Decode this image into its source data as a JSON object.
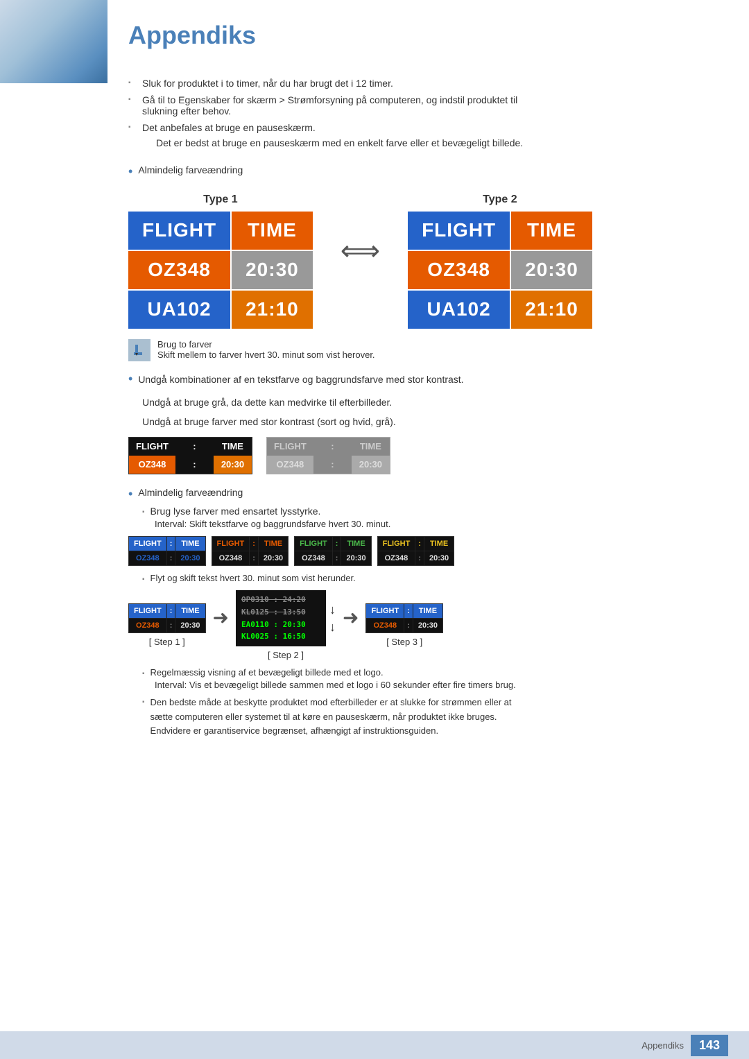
{
  "page": {
    "title": "Appendiks",
    "footer_label": "Appendiks",
    "footer_page": "143"
  },
  "bullets": {
    "b1": "Sluk for produktet i to timer, når du har brugt det i 12 timer.",
    "b2_1": "Gå til to Egenskaber for skærm > Strømforsyning på computeren, og indstil produktet til",
    "b2_2": "slukning efter behov.",
    "b3": "Det anbefales at bruge en pauseskærm.",
    "b3_sub": "Det er bedst at bruge en pauseskærm med en enkelt farve eller et bevægeligt billede.",
    "b_color": "Almindelig farveændring"
  },
  "type_labels": {
    "type1": "Type 1",
    "type2": "Type 2"
  },
  "flight_board_type1": {
    "header_left": "FLIGHT",
    "header_right": "TIME",
    "row1_left": "OZ348",
    "row1_right": "20:30",
    "row2_left": "UA102",
    "row2_right": "21:10"
  },
  "flight_board_type2": {
    "header_left": "FLIGHT",
    "header_right": "TIME",
    "row1_left": "OZ348",
    "row1_right": "20:30",
    "row2_left": "UA102",
    "row2_right": "21:10"
  },
  "note": {
    "label": "Brug to farver",
    "desc": "Skift mellem to farver hvert 30. minut som vist herover."
  },
  "section2": {
    "bullet": "Undgå kombinationer af en tekstfarve og baggrundsfarve med stor kontrast.",
    "line2": "Undgå at bruge grå, da dette kan medvirke til efterbilleder.",
    "line3": "Undgå at bruge farver med stor kontrast (sort og hvid, grå)."
  },
  "contrast_boards": {
    "board1": {
      "header_left": "FLIGHT",
      "header_colon": ":",
      "header_right": "TIME",
      "row_left": "OZ348",
      "row_colon": ":",
      "row_right": "20:30"
    },
    "board2": {
      "header_left": "FLIGHT",
      "header_colon": ":",
      "header_right": "TIME",
      "row_left": "OZ348",
      "row_colon": ":",
      "row_right": "20:30"
    }
  },
  "section3": {
    "bullet": "Almindelig farveændring",
    "sub1": "Brug lyse farver med ensartet lysstyrke.",
    "sub1_note": "Interval: Skift tekstfarve og baggrundsfarve hvert 30. minut."
  },
  "color_boards": [
    {
      "header_left": "FLIGHT",
      "header_colon": ":",
      "header_right": "TIME",
      "row_left": "OZ348",
      "row_colon": ":",
      "row_right": "20:30",
      "h_bg": "#2563c9",
      "h_color": "#fff",
      "r_bg": "#111",
      "r_color": "#2563c9"
    },
    {
      "header_left": "FLIGHT",
      "header_colon": ":",
      "header_right": "TIME",
      "row_left": "OZ348",
      "row_colon": ":",
      "row_right": "20:30",
      "h_bg": "#111",
      "h_color": "#e55a00",
      "r_bg": "#111",
      "r_color": "#e0e0e0"
    },
    {
      "header_left": "FLIGHT",
      "header_colon": ":",
      "header_right": "TIME",
      "row_left": "OZ348",
      "row_colon": ":",
      "row_right": "20:30",
      "h_bg": "#111",
      "h_color": "#4ab84a",
      "r_bg": "#111",
      "r_color": "#e0e0e0"
    },
    {
      "header_left": "FLIGHT",
      "header_colon": ":",
      "header_right": "TIME",
      "row_left": "OZ348",
      "row_colon": ":",
      "row_right": "20:30",
      "h_bg": "#111",
      "h_color": "#e8c020",
      "r_bg": "#111",
      "r_color": "#e0e0e0"
    }
  ],
  "section4": {
    "sub2": "Flyt og skift tekst hvert 30. minut som vist herunder."
  },
  "steps": {
    "step1_label": "[ Step 1 ]",
    "step2_label": "[ Step 2 ]",
    "step3_label": "[ Step 3 ]",
    "board_header_left": "FLIGHT",
    "board_header_colon": ":",
    "board_header_right": "TIME",
    "board_row_left": "OZ348",
    "board_row_colon": ":",
    "board_row_right": "20:30",
    "scroll_lines": [
      "OP0310 : 24:20",
      "KL0125 : 13:50",
      "EA0110 : 20:30",
      "KL0025 : 16:50"
    ]
  },
  "section5": {
    "sub3": "Regelmæssig visning af et bevægeligt billede med et logo.",
    "sub3_note": "Interval: Vis et bevægeligt billede sammen med et logo i 60 sekunder efter fire timers brug.",
    "sub4_1": "Den bedste måde at beskytte produktet mod efterbilleder er at slukke for strømmen eller at",
    "sub4_2": "sætte computeren eller systemet til at køre en pauseskærm, når produktet ikke bruges.",
    "sub4_3": "Endvidere er garantiservice begrænset, afhængigt af instruktionsguiden."
  }
}
